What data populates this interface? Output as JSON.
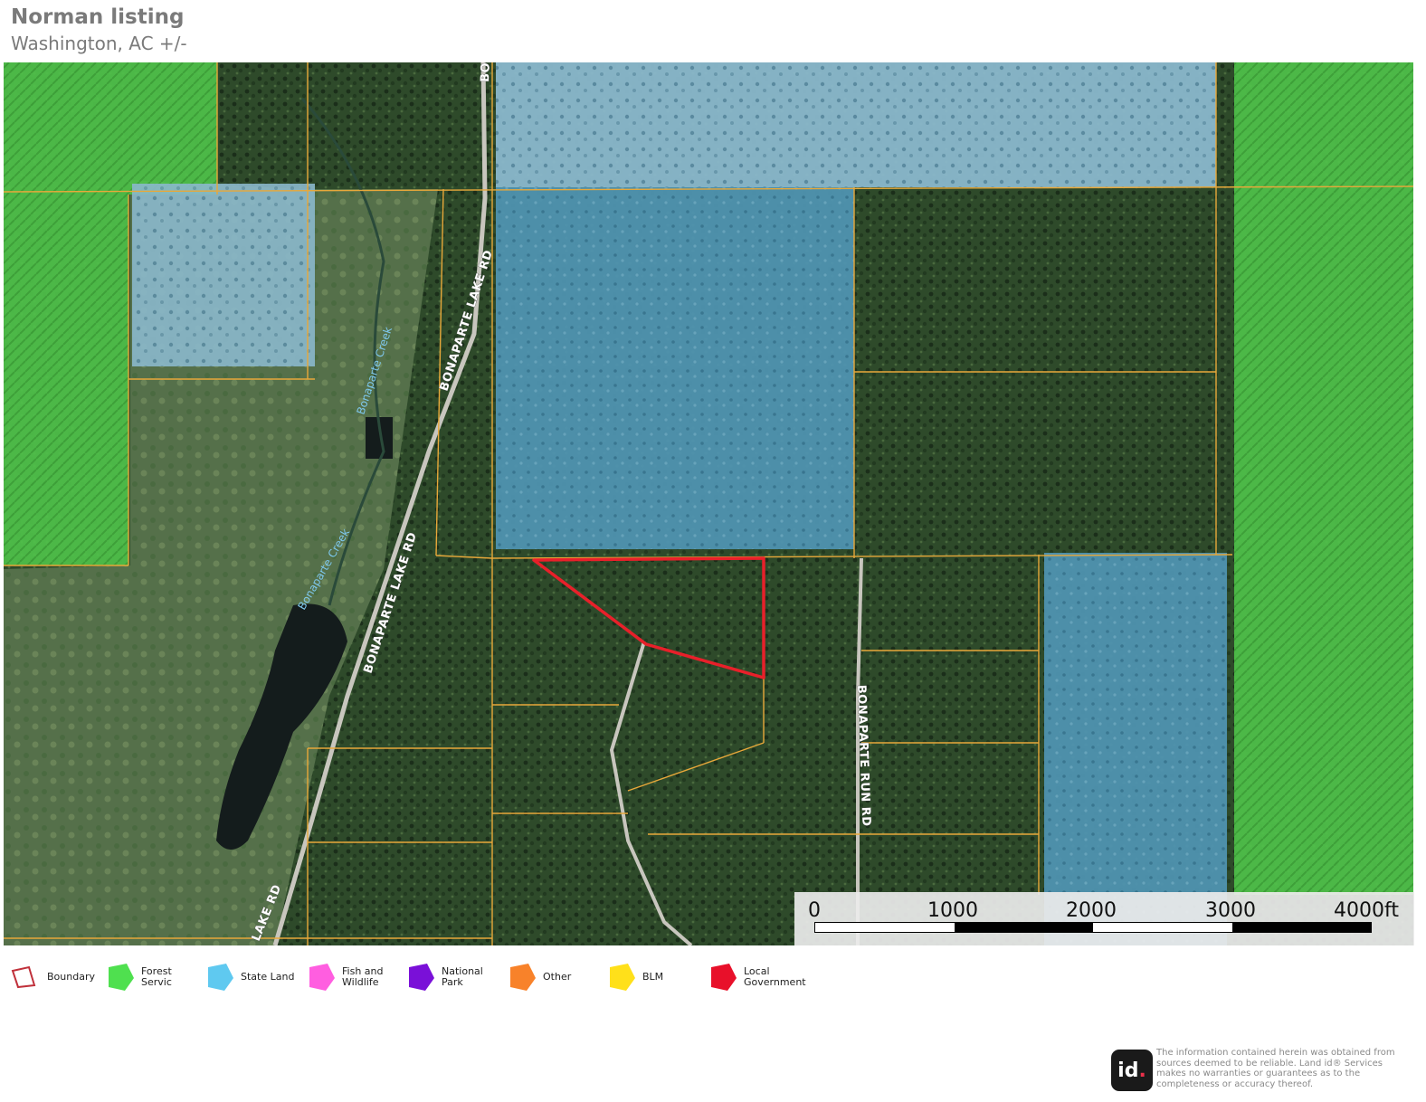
{
  "header": {
    "title": "Norman listing",
    "subtitle": "Washington,  AC +/-"
  },
  "map": {
    "road_labels": {
      "bonaparte_lake_rd_north": "BONAPARTE LAKE RD",
      "bonaparte_lake_rd_middle": "BONAPARTE LAKE RD",
      "bonaparte_lake_rd_south": "LAKE RD",
      "bonaparte_lake_rd_top": "BO",
      "bonaparte_run_rd": "BONAPARTE RUN RD"
    },
    "creek_labels": {
      "creek_north": "Bonaparte Creek",
      "creek_south": "Bonaparte Creek"
    },
    "colors": {
      "forest_service": "#4fcf4f",
      "state_land": "#5fbfe0",
      "boundary": "#e8202a",
      "parcel_lines": "#e8a83a"
    }
  },
  "scalebar": {
    "labels": [
      "0",
      "1000",
      "2000",
      "3000",
      "4000ft"
    ]
  },
  "legend": {
    "items": [
      {
        "key": "boundary",
        "label": "Boundary",
        "color": "#c0303a",
        "icon": "boundary-outline-icon"
      },
      {
        "key": "forest",
        "label": "Forest Servic",
        "color": "#4fe04f",
        "icon": "forest-service-swatch-icon"
      },
      {
        "key": "state",
        "label": "State Land",
        "color": "#5fc9f0",
        "icon": "state-land-swatch-icon"
      },
      {
        "key": "fish",
        "label": "Fish and\nWildlife",
        "color": "#ff5ee0",
        "icon": "fish-wildlife-swatch-icon"
      },
      {
        "key": "park",
        "label": "National Park",
        "color": "#7a10d8",
        "icon": "national-park-swatch-icon"
      },
      {
        "key": "other",
        "label": "Other",
        "color": "#f8822a",
        "icon": "other-swatch-icon"
      },
      {
        "key": "blm",
        "label": "BLM",
        "color": "#ffe01a",
        "icon": "blm-swatch-icon"
      },
      {
        "key": "local",
        "label": "Local\nGovernment",
        "color": "#e8102a",
        "icon": "local-government-swatch-icon"
      }
    ]
  },
  "footer": {
    "logo_text": "id",
    "logo_dot": ".",
    "disclaimer": "The information contained herein was obtained from sources deemed to be reliable. Land id® Services makes no warranties or guarantees as to the completeness or accuracy thereof."
  }
}
